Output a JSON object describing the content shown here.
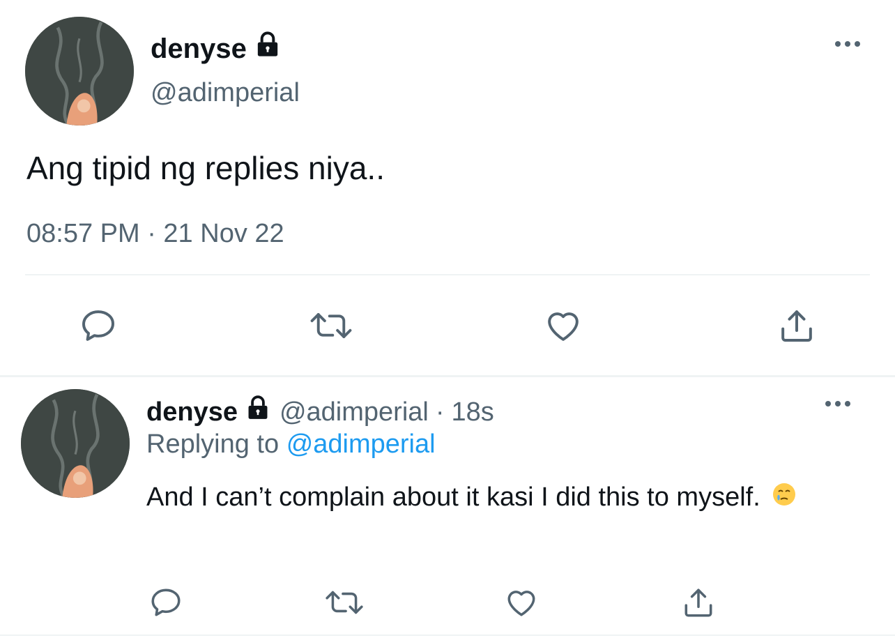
{
  "main_tweet": {
    "display_name": "denyse",
    "handle": "@adimperial",
    "text": "Ang tipid ng replies niya..",
    "timestamp": "08:57 PM · 21 Nov 22",
    "protected_icon": "lock-icon",
    "more_icon": "more-icon",
    "actions": [
      "reply-icon",
      "retweet-icon",
      "like-icon",
      "share-icon"
    ]
  },
  "reply_tweet": {
    "display_name": "denyse",
    "handle": "@adimperial",
    "separator": "·",
    "age": "18s",
    "replying_prefix": "Replying to",
    "replying_to": "@adimperial",
    "text": "And I can’t complain about it kasi I did this to myself.",
    "emoji": "face-holding-back-tears",
    "protected_icon": "lock-icon",
    "more_icon": "more-icon",
    "actions": [
      "reply-icon",
      "retweet-icon",
      "like-icon",
      "share-icon"
    ]
  },
  "colors": {
    "text_primary": "#0f1419",
    "text_secondary": "#536471",
    "link": "#1d9bf0",
    "divider": "#eff3f4"
  }
}
